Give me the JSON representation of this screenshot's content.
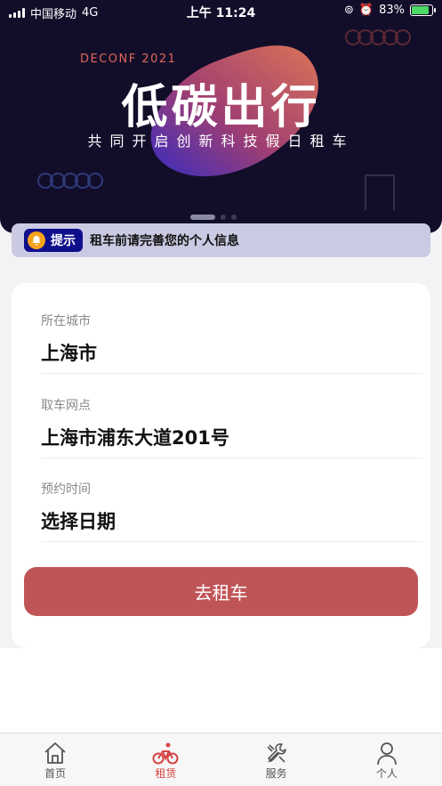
{
  "status_bar": {
    "carrier": "中国移动",
    "network": "4G",
    "time": "上午 11:24",
    "battery": "83%"
  },
  "banner": {
    "brand": "DECONF 2021",
    "title": "低碳出行",
    "subtitle": "共同开启创新科技假日租车",
    "accent_color": "#e0655a"
  },
  "notice": {
    "tag": "提示",
    "message": "租车前请完善您的个人信息"
  },
  "form": {
    "fields": [
      {
        "label": "所在城市",
        "value": "上海市"
      },
      {
        "label": "取车网点",
        "value": "上海市浦东大道201号"
      },
      {
        "label": "预约时间",
        "value": "选择日期"
      }
    ],
    "submit_label": "去租车",
    "submit_color": "#c05558"
  },
  "tabbar": {
    "items": [
      {
        "label": "首页",
        "icon": "home-icon",
        "active": false
      },
      {
        "label": "租赁",
        "icon": "bicycle-icon",
        "active": true
      },
      {
        "label": "服务",
        "icon": "tools-icon",
        "active": false
      },
      {
        "label": "个人",
        "icon": "person-icon",
        "active": false
      }
    ],
    "active_color": "#d64545"
  }
}
